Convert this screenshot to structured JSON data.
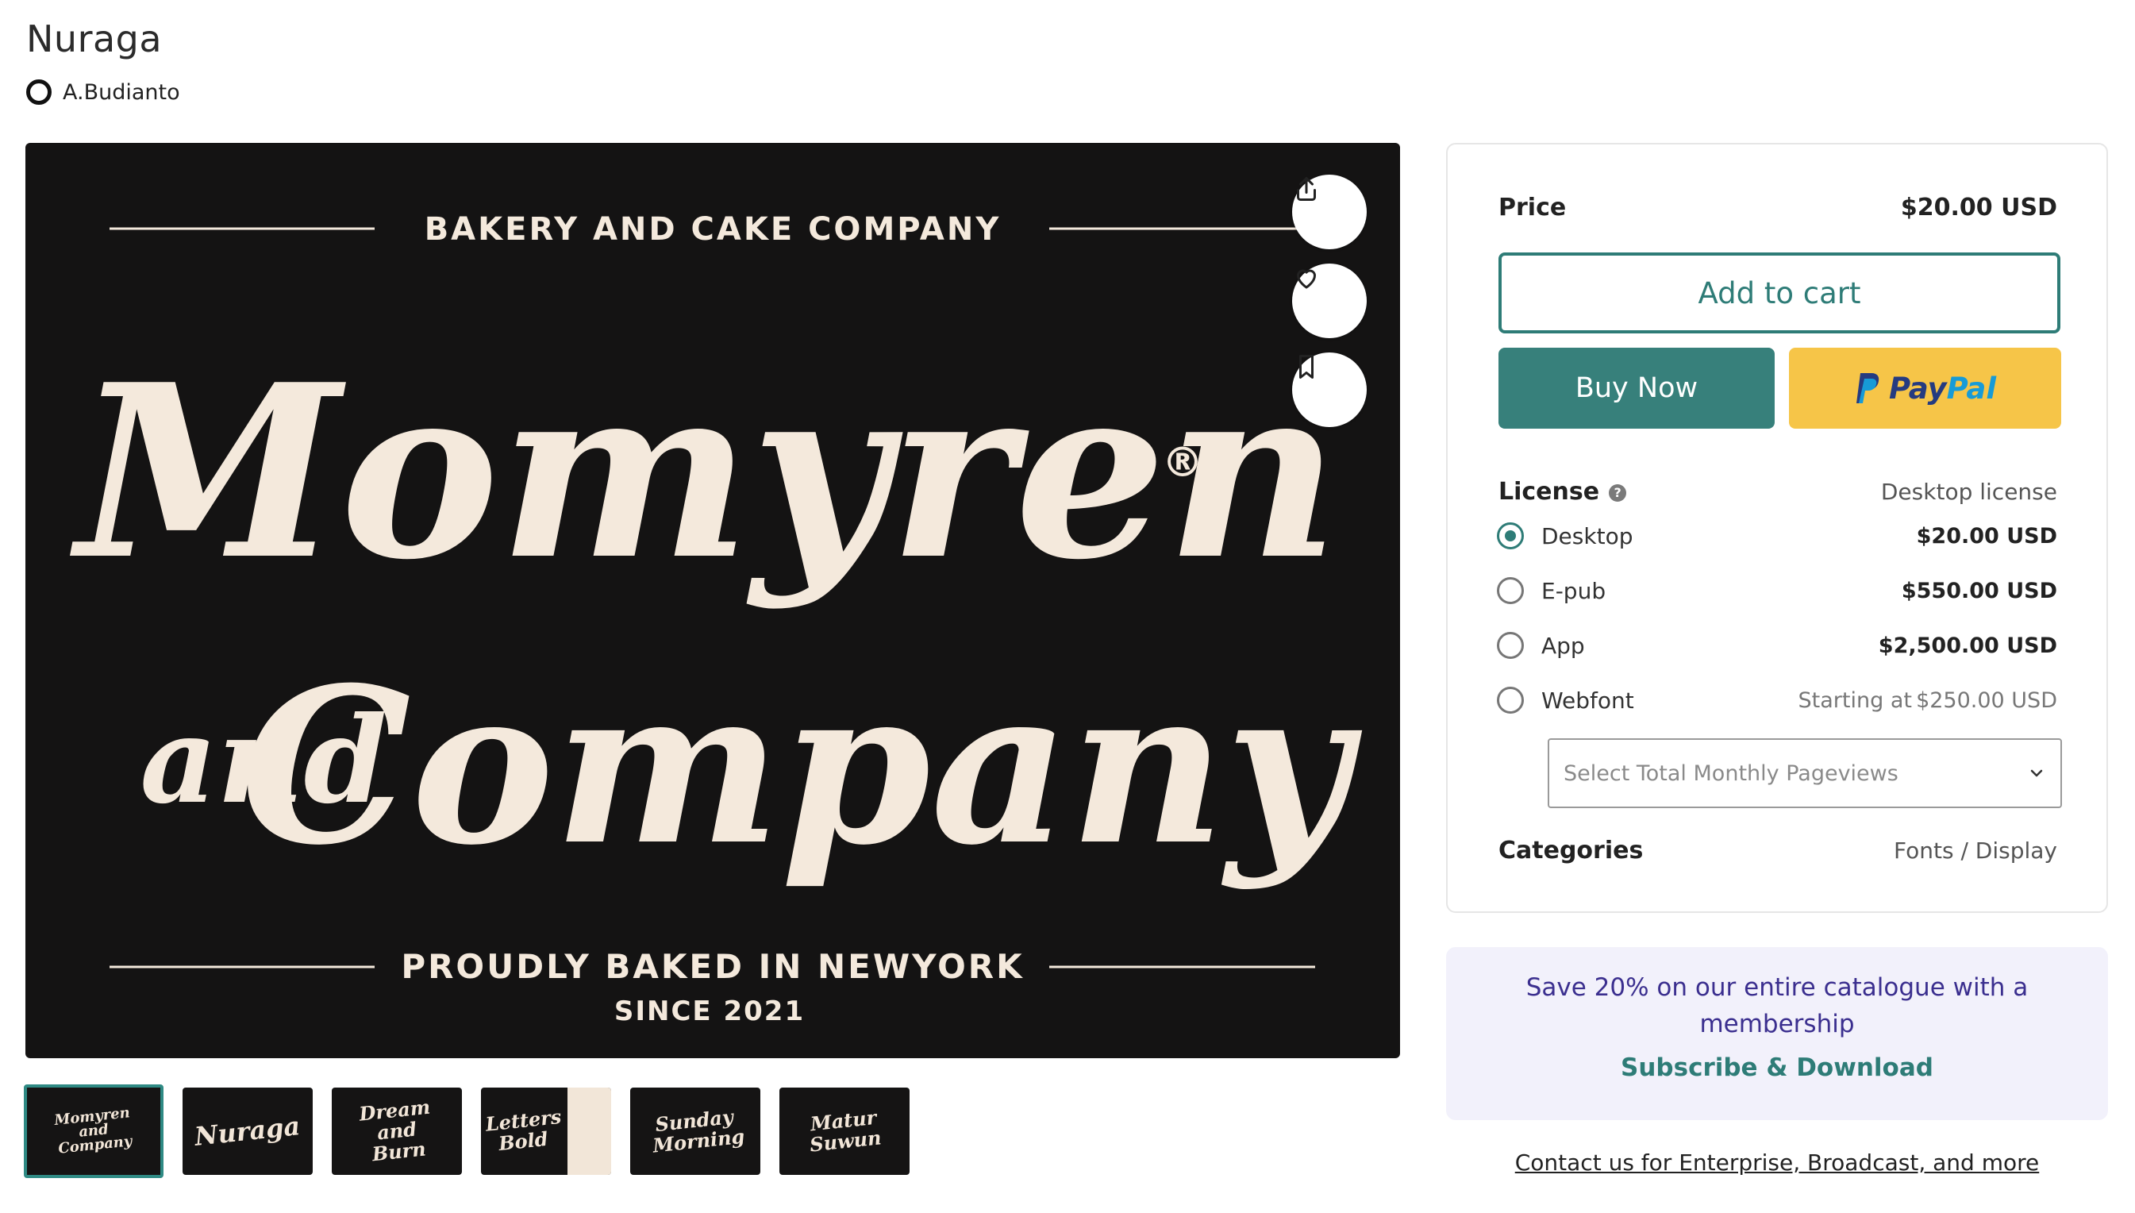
{
  "product": {
    "title": "Nuraga",
    "author": "A.Budianto"
  },
  "hero": {
    "top_text": "BAKERY AND CAKE COMPANY",
    "script_line1": "Momyren",
    "script_line2_small": "and",
    "script_line2": "Company",
    "registered": "®",
    "bottom_text": "PROUDLY BAKED IN NEWYORK",
    "since_text": "SINCE 2021",
    "bg_color": "#141313",
    "text_color": "#f4e9dc"
  },
  "actions": {
    "share_icon": "share-icon",
    "favorite_icon": "heart-icon",
    "bookmark_icon": "bookmark-icon"
  },
  "thumbnails": [
    {
      "label": "Momyren and Company"
    },
    {
      "label": "Nuraga"
    },
    {
      "label": "Dream and Burn"
    },
    {
      "label": "Letters Bold"
    },
    {
      "label": "Sunday Morning"
    },
    {
      "label": "Matur Suwun"
    }
  ],
  "purchase": {
    "price_label": "Price",
    "price_value": "$20.00 USD",
    "add_to_cart": "Add to cart",
    "buy_now": "Buy Now",
    "paypal_pay": "Pay",
    "paypal_pal": "Pal",
    "license_label": "License",
    "license_selected": "Desktop license",
    "licenses": [
      {
        "name": "Desktop",
        "price": "$20.00 USD",
        "checked": true
      },
      {
        "name": "E-pub",
        "price": "$550.00 USD",
        "checked": false
      },
      {
        "name": "App",
        "price": "$2,500.00 USD",
        "checked": false
      },
      {
        "name": "Webfont",
        "prefix": "Starting at",
        "price": "$250.00 USD",
        "checked": false
      }
    ],
    "pageviews_placeholder": "Select Total Monthly Pageviews",
    "categories_label": "Categories",
    "categories_value": "Fonts / Display"
  },
  "promo": {
    "text": "Save 20% on our entire catalogue with a membership",
    "link": "Subscribe & Download"
  },
  "contact_link": "Contact us for Enterprise, Broadcast, and more",
  "colors": {
    "teal": "#37807b",
    "paypal_yellow": "#f6c548",
    "promo_bg": "#f2f1fb",
    "promo_text": "#3b2f8f"
  }
}
